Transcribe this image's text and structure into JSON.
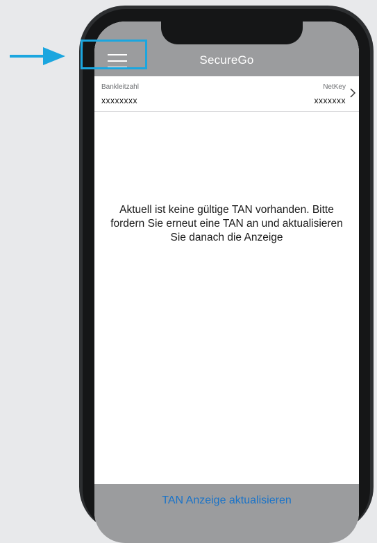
{
  "app": {
    "title": "SecureGo"
  },
  "account": {
    "bank_code_label": "Bankleitzahl",
    "bank_code_value": "xxxxxxxx",
    "netkey_label": "NetKey",
    "netkey_value": "xxxxxxx"
  },
  "message": "Aktuell ist keine gültige TAN vorhanden. Bitte fordern Sie erneut eine TAN an und aktualisieren Sie danach die Anzeige",
  "footer": {
    "refresh_label": "TAN Anzeige aktualisieren"
  },
  "icons": {
    "menu": "hamburger-menu-icon",
    "chevron": "chevron-right-icon",
    "pointer": "arrow-right-icon"
  },
  "colors": {
    "pointer": "#1ba6df",
    "highlight": "#1ba6df",
    "bar": "#9b9c9e",
    "link": "#1a73c8",
    "phone_frame": "#151617"
  }
}
